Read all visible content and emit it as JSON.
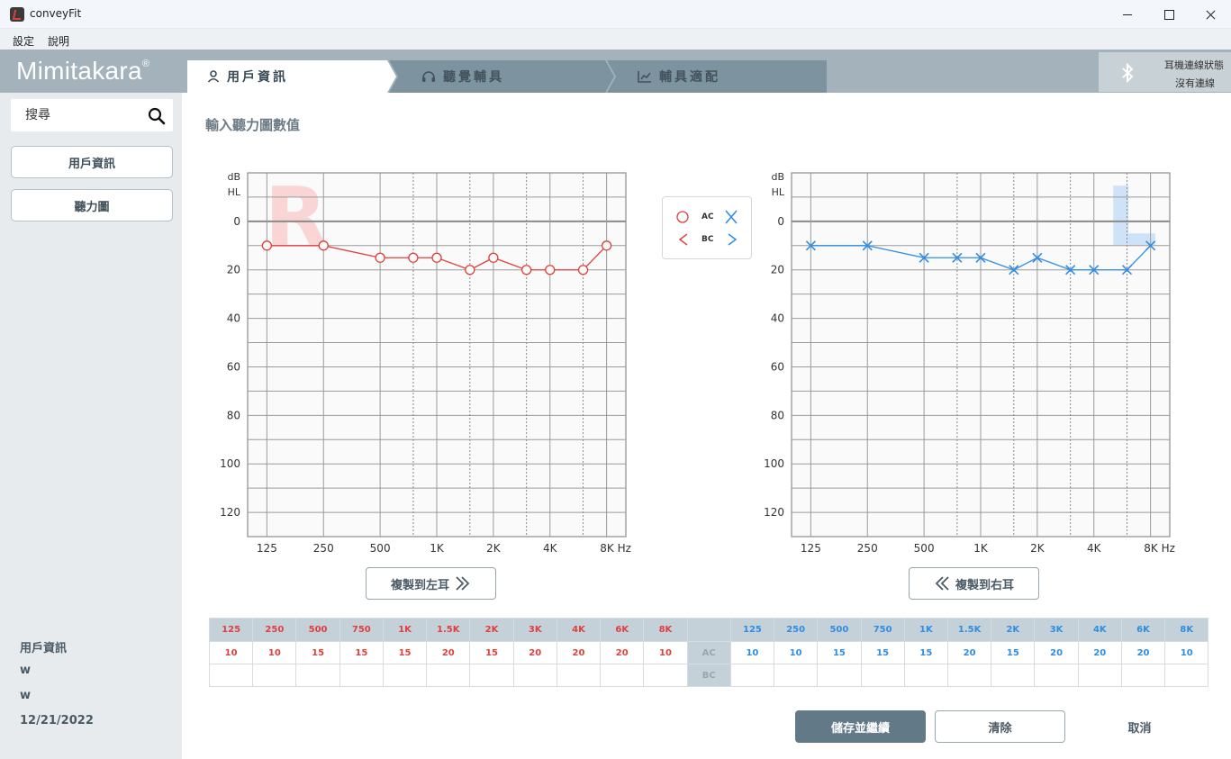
{
  "window": {
    "title": "conveyFit"
  },
  "menu": {
    "settings": "設定",
    "help": "說明"
  },
  "header": {
    "brand": "Mimitakara",
    "brand_mark": "®",
    "steps": [
      "用戶資訊",
      "聽覺輔具",
      "輔具適配"
    ],
    "bluetooth": {
      "title": "耳機連線狀態",
      "status": "沒有連線"
    }
  },
  "sidebar": {
    "search_placeholder": "搜尋",
    "buttons": [
      "用戶資訊",
      "聽力圖"
    ],
    "info": {
      "heading": "用戶資訊",
      "line1": "w",
      "line2": "w",
      "date": "12/21/2022"
    }
  },
  "main": {
    "title": "輸入聽力圖數值",
    "copy_left": "複製到左耳",
    "copy_right": "複製到右耳",
    "legend": {
      "ac": "AC",
      "bc": "BC"
    },
    "buttons": {
      "save": "儲存並繼續",
      "clear": "清除",
      "cancel": "取消"
    }
  },
  "chart_data": [
    {
      "type": "line",
      "ear_letter": "R",
      "ylabel": "dB HL",
      "xunit": "Hz",
      "y_ticks": [
        "0",
        "20",
        "40",
        "60",
        "80",
        "100",
        "120"
      ],
      "ylim": [
        -20,
        130
      ],
      "x_ticks": [
        "125",
        "250",
        "500",
        "1K",
        "2K",
        "4K",
        "8K"
      ],
      "series": [
        {
          "name": "AC",
          "color": "#e0403d",
          "marker": "circle",
          "x": [
            125,
            250,
            500,
            750,
            1000,
            1500,
            2000,
            3000,
            4000,
            6000,
            8000
          ],
          "values": [
            10,
            10,
            15,
            15,
            15,
            20,
            15,
            20,
            20,
            20,
            10
          ]
        }
      ]
    },
    {
      "type": "line",
      "ear_letter": "L",
      "ylabel": "dB HL",
      "xunit": "Hz",
      "y_ticks": [
        "0",
        "20",
        "40",
        "60",
        "80",
        "100",
        "120"
      ],
      "ylim": [
        -20,
        130
      ],
      "x_ticks": [
        "125",
        "250",
        "500",
        "1K",
        "2K",
        "4K",
        "8K"
      ],
      "series": [
        {
          "name": "AC",
          "color": "#2f8de4",
          "marker": "cross",
          "x": [
            125,
            250,
            500,
            750,
            1000,
            1500,
            2000,
            3000,
            4000,
            6000,
            8000
          ],
          "values": [
            10,
            10,
            15,
            15,
            15,
            20,
            15,
            20,
            20,
            20,
            10
          ]
        }
      ]
    }
  ],
  "table": {
    "freqs": [
      "125",
      "250",
      "500",
      "750",
      "1K",
      "1.5K",
      "2K",
      "3K",
      "4K",
      "6K",
      "8K"
    ],
    "row_labels": [
      "AC",
      "BC"
    ],
    "right_ac": [
      "10",
      "10",
      "15",
      "15",
      "15",
      "20",
      "15",
      "20",
      "20",
      "20",
      "10"
    ],
    "left_ac": [
      "10",
      "10",
      "15",
      "15",
      "15",
      "20",
      "15",
      "20",
      "20",
      "20",
      "10"
    ]
  }
}
